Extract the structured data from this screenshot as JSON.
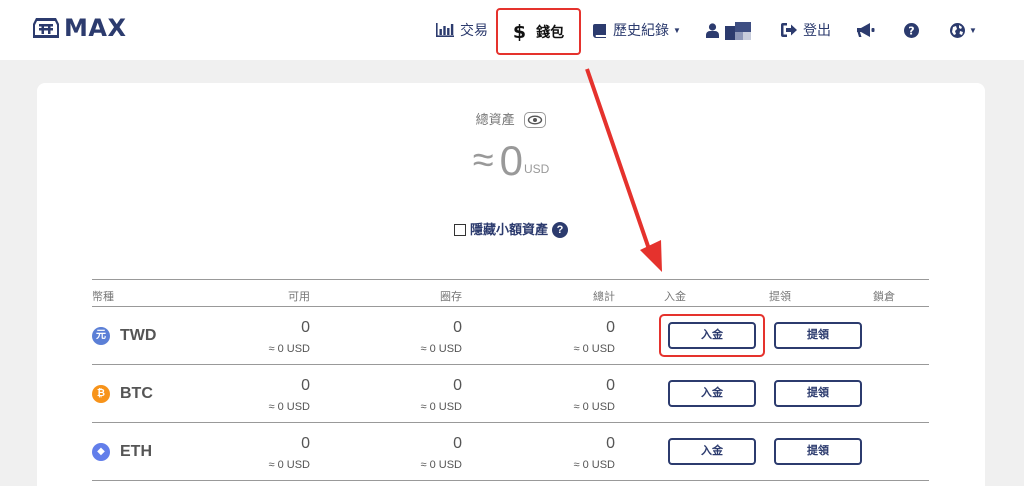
{
  "brand": {
    "name": "MAX"
  },
  "nav": {
    "trade": "交易",
    "wallet_symbol": "$",
    "wallet": "錢包",
    "history": "歷史紀錄",
    "logout": "登出"
  },
  "summary": {
    "total_label": "總資產",
    "approx_symbol": "≈",
    "total_value": "0",
    "total_currency": "USD",
    "hide_small_label": "隱藏小額資產",
    "help_glyph": "?"
  },
  "table": {
    "headers": [
      "幣種",
      "可用",
      "圈存",
      "總計",
      "入金",
      "提領",
      "鎖倉"
    ],
    "rows": [
      {
        "symbol": "TWD",
        "icon_glyph": "元",
        "icon_color": "#5b7fd6",
        "available": "0",
        "available_usd": "≈ 0 USD",
        "frozen": "0",
        "frozen_usd": "≈ 0 USD",
        "total": "0",
        "total_usd": "≈ 0 USD",
        "deposit": "入金",
        "withdraw": "提領"
      },
      {
        "symbol": "BTC",
        "icon_glyph": "₿",
        "icon_color": "#f7931a",
        "available": "0",
        "available_usd": "≈ 0 USD",
        "frozen": "0",
        "frozen_usd": "≈ 0 USD",
        "total": "0",
        "total_usd": "≈ 0 USD",
        "deposit": "入金",
        "withdraw": "提領"
      },
      {
        "symbol": "ETH",
        "icon_glyph": "◆",
        "icon_color": "#627eea",
        "available": "0",
        "available_usd": "≈ 0 USD",
        "frozen": "0",
        "frozen_usd": "≈ 0 USD",
        "total": "0",
        "total_usd": "≈ 0 USD",
        "deposit": "入金",
        "withdraw": "提領"
      }
    ]
  },
  "colors": {
    "brand_navy": "#2c3b6e",
    "annotation_red": "#e5322d",
    "background": "#f0f0f0"
  }
}
